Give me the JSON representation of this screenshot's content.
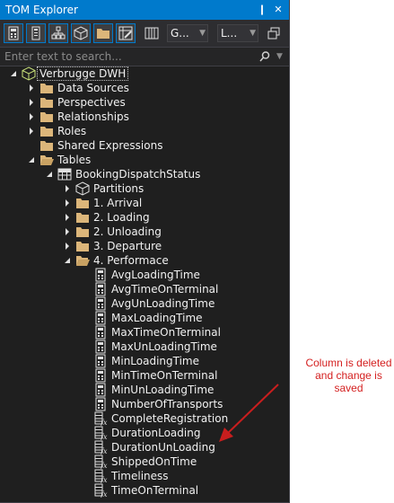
{
  "window": {
    "title": "TOM Explorer",
    "pin_glyph": "❙",
    "close_glyph": "✕"
  },
  "toolbar": {
    "combo1": "G...",
    "combo2": "L...",
    "buttons": [
      "calculator-icon",
      "phone-icon",
      "hierarchy-icon",
      "box-icon",
      "folder-icon",
      "grid-edit-icon",
      "columns-icon",
      "copy-windows-icon"
    ]
  },
  "search": {
    "placeholder": "Enter text to search..."
  },
  "tree": [
    {
      "label": "Verbrugge DWH",
      "level": 0,
      "icon": "model",
      "expander": "expanded",
      "selected": true
    },
    {
      "label": "Data Sources",
      "level": 1,
      "icon": "folder",
      "expander": "collapsed"
    },
    {
      "label": "Perspectives",
      "level": 1,
      "icon": "folder",
      "expander": "collapsed"
    },
    {
      "label": "Relationships",
      "level": 1,
      "icon": "folder",
      "expander": "collapsed"
    },
    {
      "label": "Roles",
      "level": 1,
      "icon": "folder",
      "expander": "collapsed"
    },
    {
      "label": "Shared Expressions",
      "level": 1,
      "icon": "folder",
      "expander": "none"
    },
    {
      "label": "Tables",
      "level": 1,
      "icon": "folder-open",
      "expander": "expanded"
    },
    {
      "label": "BookingDispatchStatus",
      "level": 2,
      "icon": "table",
      "expander": "expanded"
    },
    {
      "label": "Partitions",
      "level": 3,
      "icon": "partition",
      "expander": "collapsed"
    },
    {
      "label": "1. Arrival",
      "level": 3,
      "icon": "folder",
      "expander": "collapsed"
    },
    {
      "label": "2. Loading",
      "level": 3,
      "icon": "folder",
      "expander": "collapsed"
    },
    {
      "label": "2. Unloading",
      "level": 3,
      "icon": "folder",
      "expander": "collapsed"
    },
    {
      "label": "3. Departure",
      "level": 3,
      "icon": "folder",
      "expander": "collapsed"
    },
    {
      "label": "4. Performace",
      "level": 3,
      "icon": "folder-open",
      "expander": "expanded"
    },
    {
      "label": "AvgLoadingTime",
      "level": 4,
      "icon": "measure",
      "expander": "none"
    },
    {
      "label": "AvgTimeOnTerminal",
      "level": 4,
      "icon": "measure",
      "expander": "none"
    },
    {
      "label": "AvgUnLoadingTime",
      "level": 4,
      "icon": "measure",
      "expander": "none"
    },
    {
      "label": "MaxLoadingTime",
      "level": 4,
      "icon": "measure",
      "expander": "none"
    },
    {
      "label": "MaxTimeOnTerminal",
      "level": 4,
      "icon": "measure",
      "expander": "none"
    },
    {
      "label": "MaxUnLoadingTime",
      "level": 4,
      "icon": "measure",
      "expander": "none"
    },
    {
      "label": "MinLoadingTime",
      "level": 4,
      "icon": "measure",
      "expander": "none"
    },
    {
      "label": "MinTimeOnTerminal",
      "level": 4,
      "icon": "measure",
      "expander": "none"
    },
    {
      "label": "MinUnLoadingTime",
      "level": 4,
      "icon": "measure",
      "expander": "none"
    },
    {
      "label": "NumberOfTransports",
      "level": 4,
      "icon": "measure",
      "expander": "none"
    },
    {
      "label": "CompleteRegistration",
      "level": 4,
      "icon": "calc-column",
      "expander": "none"
    },
    {
      "label": "DurationLoading",
      "level": 4,
      "icon": "calc-column",
      "expander": "none"
    },
    {
      "label": "DurationUnLoading",
      "level": 4,
      "icon": "calc-column",
      "expander": "none"
    },
    {
      "label": "ShippedOnTime",
      "level": 4,
      "icon": "calc-column",
      "expander": "none"
    },
    {
      "label": "Timeliness",
      "level": 4,
      "icon": "calc-column",
      "expander": "none"
    },
    {
      "label": "TimeOnTerminal",
      "level": 4,
      "icon": "calc-column",
      "expander": "none"
    }
  ],
  "annotation": {
    "text": "Column is deleted and change is saved",
    "color": "#d42020"
  },
  "colors": {
    "accent": "#007acc",
    "panel_bg": "#1f1f1f",
    "folder": "#dcb67a",
    "text": "#f1f1f1"
  }
}
